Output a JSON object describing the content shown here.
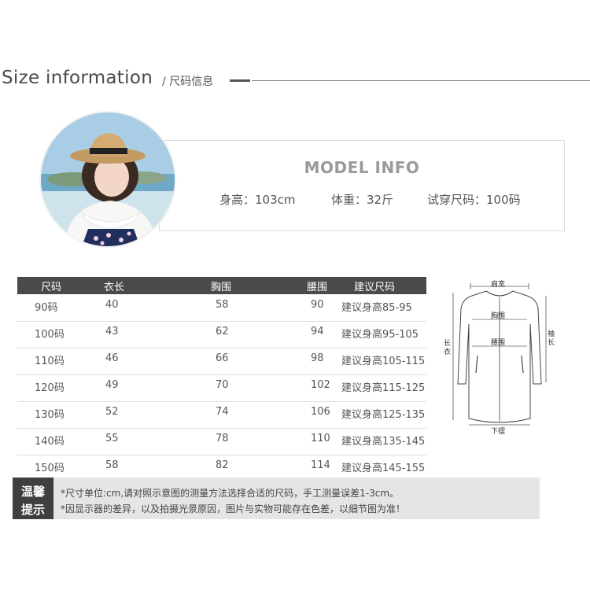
{
  "header": {
    "title": "Size information",
    "subtitle": "/ 尺码信息"
  },
  "model": {
    "title": "MODEL INFO",
    "height": "身高：103cm",
    "weight": "体重：32斤",
    "size": "试穿尺码：100码"
  },
  "table": {
    "headers": [
      "尺码",
      "衣长",
      "胸围",
      "腰围",
      "建议尺码"
    ],
    "rows": [
      [
        "90码",
        "40",
        "58",
        "90",
        "建议身高85-95"
      ],
      [
        "100码",
        "43",
        "62",
        "94",
        "建议身高95-105"
      ],
      [
        "110码",
        "46",
        "66",
        "98",
        "建议身高105-115"
      ],
      [
        "120码",
        "49",
        "70",
        "102",
        "建议身高115-125"
      ],
      [
        "130码",
        "52",
        "74",
        "106",
        "建议身高125-135"
      ],
      [
        "140码",
        "55",
        "78",
        "110",
        "建议身高135-145"
      ],
      [
        "150码",
        "58",
        "82",
        "114",
        "建议身高145-155"
      ]
    ]
  },
  "diagram": {
    "shoulder": "肩宽",
    "chest": "胸围",
    "waist": "腰围",
    "length": "长衣",
    "sleeve": "袖长",
    "hem": "下摆"
  },
  "tips": {
    "label_1": "温馨",
    "label_2": "提示",
    "line_1": "*尺寸单位:cm,请对照示意图的测量方法选择合适的尺码，手工测量误差1-3cm。",
    "line_2": "*因显示器的差异，以及拍摄光景原因，图片与实物可能存在色差，以细节图为准！"
  }
}
